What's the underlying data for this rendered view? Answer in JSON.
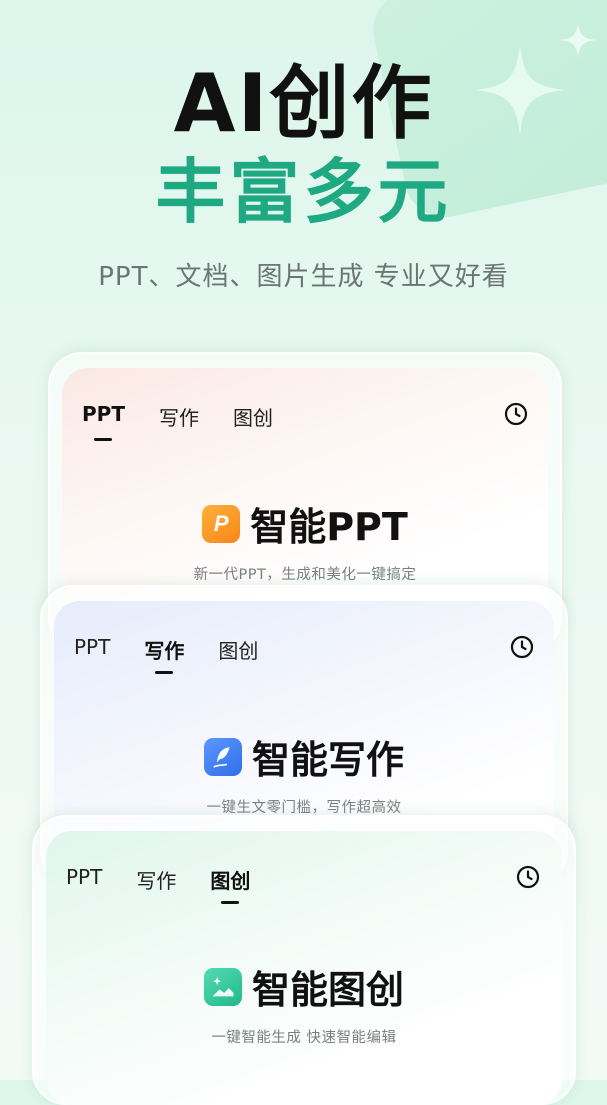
{
  "hero": {
    "title": "AI创作",
    "subtitle": "丰富多元",
    "tagline": "PPT、文档、图片生成 专业又好看"
  },
  "cards": [
    {
      "tabs": [
        "PPT",
        "写作",
        "图创"
      ],
      "active_tab": "PPT",
      "product_name": "智能PPT",
      "product_desc": "新一代PPT，生成和美化一键搞定",
      "logo_icon": "ppt-logo-icon",
      "logo_letter": "P",
      "accent": "#f79a1e"
    },
    {
      "tabs": [
        "PPT",
        "写作",
        "图创"
      ],
      "active_tab": "写作",
      "product_name": "智能写作",
      "product_desc": "一键生文零门槛，写作超高效",
      "logo_icon": "quill-logo-icon",
      "accent": "#3d7ef0"
    },
    {
      "tabs": [
        "PPT",
        "写作",
        "图创"
      ],
      "active_tab": "图创",
      "product_name": "智能图创",
      "product_desc": "一键智能生成 快速智能编辑",
      "logo_icon": "image-logo-icon",
      "accent": "#2ec79a"
    }
  ],
  "icons": {
    "history": "clock-icon",
    "decor": "sparkle-icon"
  },
  "colors": {
    "brand_green": "#1ea982",
    "title_black": "#111111"
  }
}
